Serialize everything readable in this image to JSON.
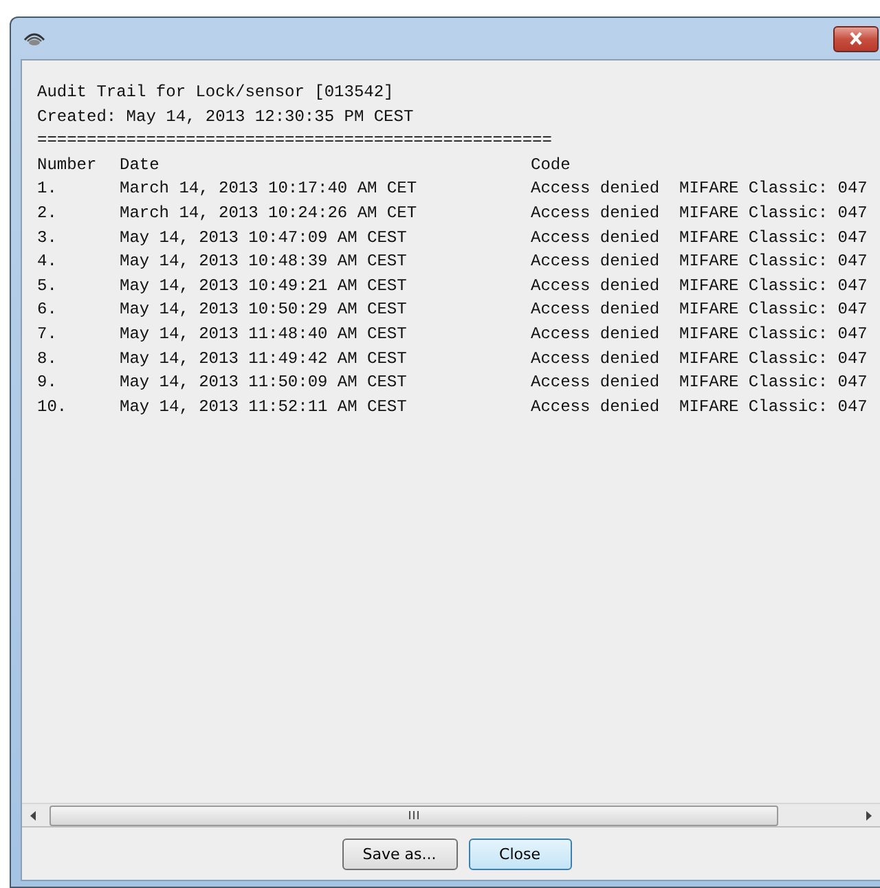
{
  "report": {
    "title": "Audit Trail for Lock/sensor [013542]",
    "created": "Created: May 14, 2013 12:30:35 PM CEST",
    "separator": "====================================================",
    "columns": [
      "Number",
      "Date",
      "Code"
    ],
    "rows": [
      {
        "number": "1.",
        "date": "March 14, 2013 10:17:40 AM CET",
        "code": "Access denied  MIFARE Classic: 047"
      },
      {
        "number": "2.",
        "date": "March 14, 2013 10:24:26 AM CET",
        "code": "Access denied  MIFARE Classic: 047"
      },
      {
        "number": "3.",
        "date": "May 14, 2013 10:47:09 AM CEST",
        "code": "Access denied  MIFARE Classic: 047"
      },
      {
        "number": "4.",
        "date": "May 14, 2013 10:48:39 AM CEST",
        "code": "Access denied  MIFARE Classic: 047"
      },
      {
        "number": "5.",
        "date": "May 14, 2013 10:49:21 AM CEST",
        "code": "Access denied  MIFARE Classic: 047"
      },
      {
        "number": "6.",
        "date": "May 14, 2013 10:50:29 AM CEST",
        "code": "Access denied  MIFARE Classic: 047"
      },
      {
        "number": "7.",
        "date": "May 14, 2013 11:48:40 AM CEST",
        "code": "Access denied  MIFARE Classic: 047"
      },
      {
        "number": "8.",
        "date": "May 14, 2013 11:49:42 AM CEST",
        "code": "Access denied  MIFARE Classic: 047"
      },
      {
        "number": "9.",
        "date": "May 14, 2013 11:50:09 AM CEST",
        "code": "Access denied  MIFARE Classic: 047"
      },
      {
        "number": "10.",
        "date": "May 14, 2013 11:52:11 AM CEST",
        "code": "Access denied  MIFARE Classic: 047"
      }
    ]
  },
  "buttons": [
    {
      "label": "Save as...",
      "focused": false
    },
    {
      "label": "Close",
      "focused": true
    }
  ]
}
